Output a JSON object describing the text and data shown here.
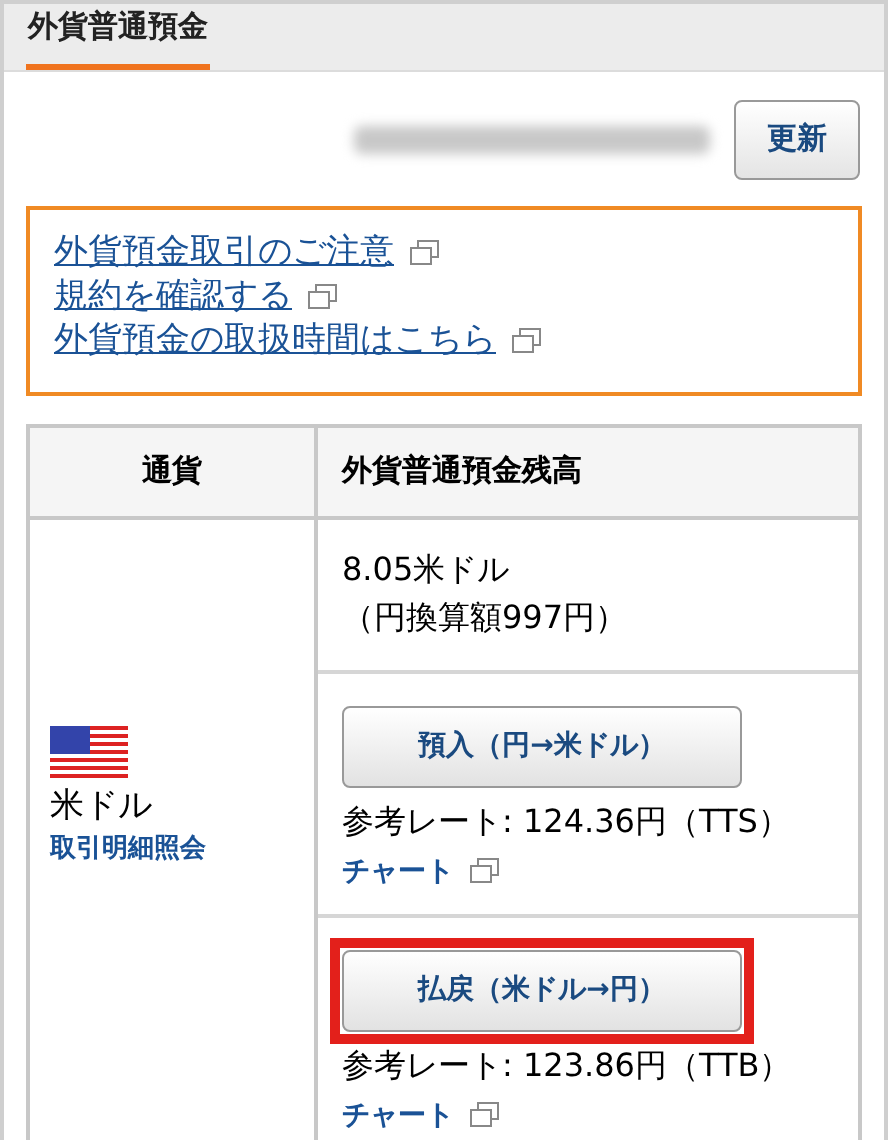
{
  "tab": {
    "label": "外貨普通預金",
    "selected": true
  },
  "refresh_button": "更新",
  "notice_links": [
    "外貨預金取引のご注意",
    "規約を確認する",
    "外貨預金の取扱時間はこちら"
  ],
  "table": {
    "columns": [
      "通貨",
      "外貨普通預金残高"
    ],
    "rows": [
      {
        "currency": "米ドル",
        "detail_link": "取引明細照会",
        "balance": "8.05米ドル",
        "balance_yen": "（円換算額997円）",
        "actions": [
          {
            "button": "預入（円→米ドル）",
            "rate": "参考レート: 124.36円（TTS）",
            "chart_link": "チャート",
            "highlighted": false
          },
          {
            "button": "払戻（米ドル→円）",
            "rate": "参考レート: 123.86円（TTB）",
            "chart_link": "チャート",
            "highlighted": true
          }
        ]
      }
    ]
  }
}
